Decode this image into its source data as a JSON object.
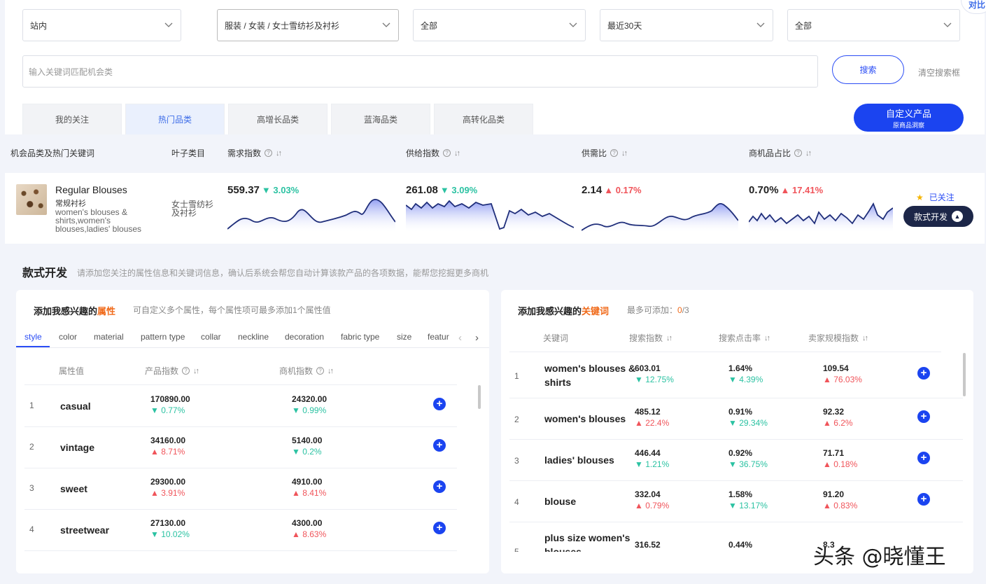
{
  "filters": {
    "site": "站内",
    "category": "服装 / 女装 / 女士雪纺衫及衬衫",
    "type": "全部",
    "period": "最近30天",
    "scope": "全部"
  },
  "search": {
    "placeholder": "输入关键词匹配机会类",
    "button": "搜索",
    "clear": "清空搜索框"
  },
  "tabs": [
    "我的关注",
    "热门品类",
    "高增长品类",
    "蓝海品类",
    "高转化品类"
  ],
  "custom_btn": {
    "line1": "自定义产品",
    "line2": "原商品洞察"
  },
  "compare": "对比",
  "table_headers": {
    "col1": "机会品类及热门关键词",
    "col2": "叶子类目",
    "demand": "需求指数",
    "supply": "供给指数",
    "ratio": "供需比",
    "opportunity": "商机品占比"
  },
  "product": {
    "name": "Regular Blouses",
    "cn_name": "常规衬衫",
    "keywords": "women's blouses & shirts,women's blouses,ladies' blouses",
    "leaf": "女士雪纺衫及衬衫",
    "demand": {
      "value": "559.37",
      "change": "3.03%",
      "dir": "down"
    },
    "supply": {
      "value": "261.08",
      "change": "3.09%",
      "dir": "down"
    },
    "ratio": {
      "value": "2.14",
      "change": "0.17%",
      "dir": "up"
    },
    "opportunity": {
      "value": "0.70%",
      "change": "17.41%",
      "dir": "up"
    },
    "followed": "已关注",
    "dev_btn": "款式开发"
  },
  "section": {
    "title": "款式开发",
    "desc": "请添加您关注的属性信息和关键词信息，确认后系统会帮您自动计算该款产品的各项数据，能帮您挖掘更多商机"
  },
  "attr_card": {
    "title_prefix": "添加我感兴趣的",
    "title_hl": "属性",
    "hint": "可自定义多个属性，每个属性项可最多添加1个属性值",
    "tabs": [
      "style",
      "color",
      "material",
      "pattern type",
      "collar",
      "neckline",
      "decoration",
      "fabric type",
      "size",
      "featur"
    ],
    "headers": {
      "name": "属性值",
      "product": "产品指数",
      "opportunity": "商机指数"
    },
    "rows": [
      {
        "idx": "1",
        "name": "casual",
        "p_val": "170890.00",
        "p_chg": "0.77%",
        "p_dir": "down",
        "o_val": "24320.00",
        "o_chg": "0.99%",
        "o_dir": "down"
      },
      {
        "idx": "2",
        "name": "vintage",
        "p_val": "34160.00",
        "p_chg": "8.71%",
        "p_dir": "up",
        "o_val": "5140.00",
        "o_chg": "0.2%",
        "o_dir": "down"
      },
      {
        "idx": "3",
        "name": "sweet",
        "p_val": "29300.00",
        "p_chg": "3.91%",
        "p_dir": "up",
        "o_val": "4910.00",
        "o_chg": "8.41%",
        "o_dir": "up"
      },
      {
        "idx": "4",
        "name": "streetwear",
        "p_val": "27130.00",
        "p_chg": "10.02%",
        "p_dir": "down",
        "o_val": "4300.00",
        "o_chg": "8.63%",
        "o_dir": "up"
      }
    ]
  },
  "kw_card": {
    "title_prefix": "添加我感兴趣的",
    "title_hl": "关键词",
    "hint_prefix": "最多可添加：",
    "count": "0",
    "total": "/3",
    "headers": {
      "kw": "关键词",
      "search": "搜索指数",
      "ctr": "搜索点击率",
      "seller": "卖家规模指数"
    },
    "rows": [
      {
        "idx": "1",
        "kw": "women's blouses & shirts",
        "s_val": "603.01",
        "s_chg": "12.75%",
        "s_dir": "down",
        "c_val": "1.64%",
        "c_chg": "4.39%",
        "c_dir": "down",
        "m_val": "109.54",
        "m_chg": "76.03%",
        "m_dir": "up"
      },
      {
        "idx": "2",
        "kw": "women's blouses",
        "s_val": "485.12",
        "s_chg": "22.4%",
        "s_dir": "up",
        "c_val": "0.91%",
        "c_chg": "29.34%",
        "c_dir": "down",
        "m_val": "92.32",
        "m_chg": "6.2%",
        "m_dir": "up"
      },
      {
        "idx": "3",
        "kw": "ladies' blouses",
        "s_val": "446.44",
        "s_chg": "1.21%",
        "s_dir": "down",
        "c_val": "0.92%",
        "c_chg": "36.75%",
        "c_dir": "down",
        "m_val": "71.71",
        "m_chg": "0.18%",
        "m_dir": "up"
      },
      {
        "idx": "4",
        "kw": "blouse",
        "s_val": "332.04",
        "s_chg": "0.79%",
        "s_dir": "up",
        "c_val": "1.58%",
        "c_chg": "13.17%",
        "c_dir": "down",
        "m_val": "91.20",
        "m_chg": "0.83%",
        "m_dir": "up"
      },
      {
        "idx": "5",
        "kw": "plus size women's blouses",
        "s_val": "316.52",
        "s_chg": "",
        "s_dir": "up",
        "c_val": "0.44%",
        "c_chg": "",
        "c_dir": "up",
        "m_val": "8.3",
        "m_chg": "",
        "m_dir": "up"
      }
    ]
  },
  "watermark": "头条 @晓懂王",
  "colors": {
    "primary": "#1b44f0",
    "down": "#2bc2a2",
    "up": "#f0545a",
    "highlight": "#f06a1a",
    "dark_btn": "#1c2648"
  }
}
